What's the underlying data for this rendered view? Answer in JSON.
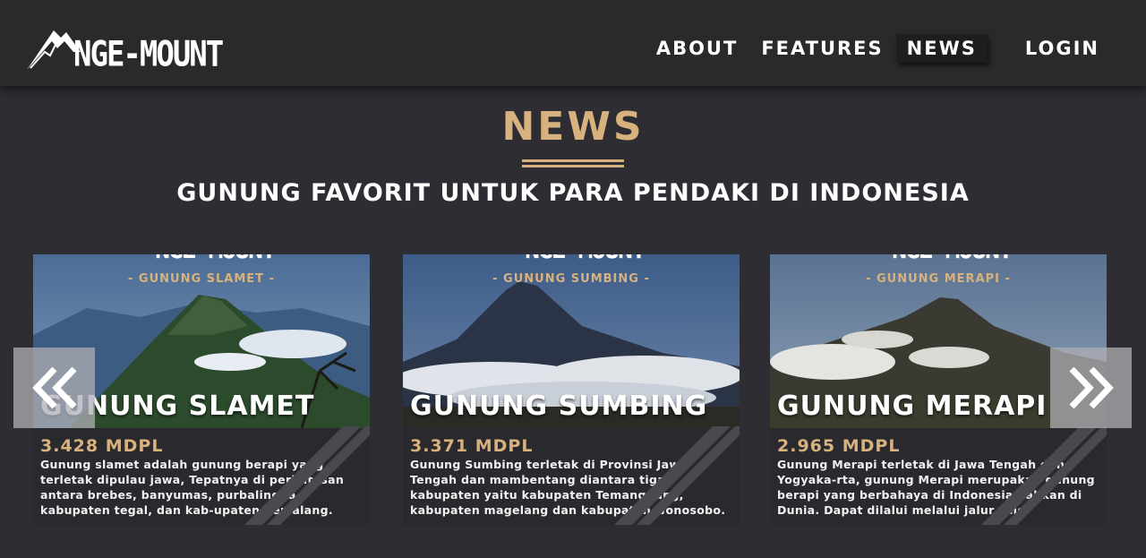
{
  "nav": {
    "logo_text": "NGE-MOUNT",
    "links": [
      "ABOUT",
      "FEATURES",
      "NEWS"
    ],
    "login": "LOGIN",
    "active": "NEWS"
  },
  "section": {
    "title": "NEWS",
    "subtitle": "GUNUNG FAVORIT UNTUK PARA PENDAKI DI INDONESIA"
  },
  "cards": [
    {
      "logo": "NGE-MOUNT",
      "tag": "- GUNUNG SLAMET -",
      "name": "GUNUNG SLAMET",
      "height": "3.428 MDPL",
      "desc": "Gunung slamet adalah gunung berapi yang terletak dipulau jawa, Tepatnya di perbatasan antara brebes, banyumas, purbalingga, kabupaten tegal, dan kab-upaten pemalang."
    },
    {
      "logo": "NGE-MOUNT",
      "tag": "- GUNUNG SUMBING -",
      "name": "GUNUNG SUMBING",
      "height": "3.371 MDPL",
      "desc": "Gunung Sumbing terletak di Provinsi Jawa Tengah dan mambentang diantara tiga kabupaten yaitu kabupaten Temanggung, kabupaten magelang dan kabupaten wonosobo."
    },
    {
      "logo": "NGE-MOUNT",
      "tag": "- GUNUNG MERAPI -",
      "name": "GUNUNG MERAPI",
      "height": "2.965 MDPL",
      "desc": "Gunung Merapi terletak di Jawa Tengah dan Yogyaka-rta, gunung Merapi merupakan gunung berapi yang berbahaya di Indonesia bahkan di Dunia. Dapat dilalui melalui jalur selo"
    }
  ],
  "arrows": {
    "prev_icon": "double-chevron-left-icon",
    "next_icon": "double-chevron-right-icon"
  },
  "colors": {
    "accent": "#d8b27e",
    "background": "#2e2d33",
    "navbar": "#2a2a2d"
  }
}
